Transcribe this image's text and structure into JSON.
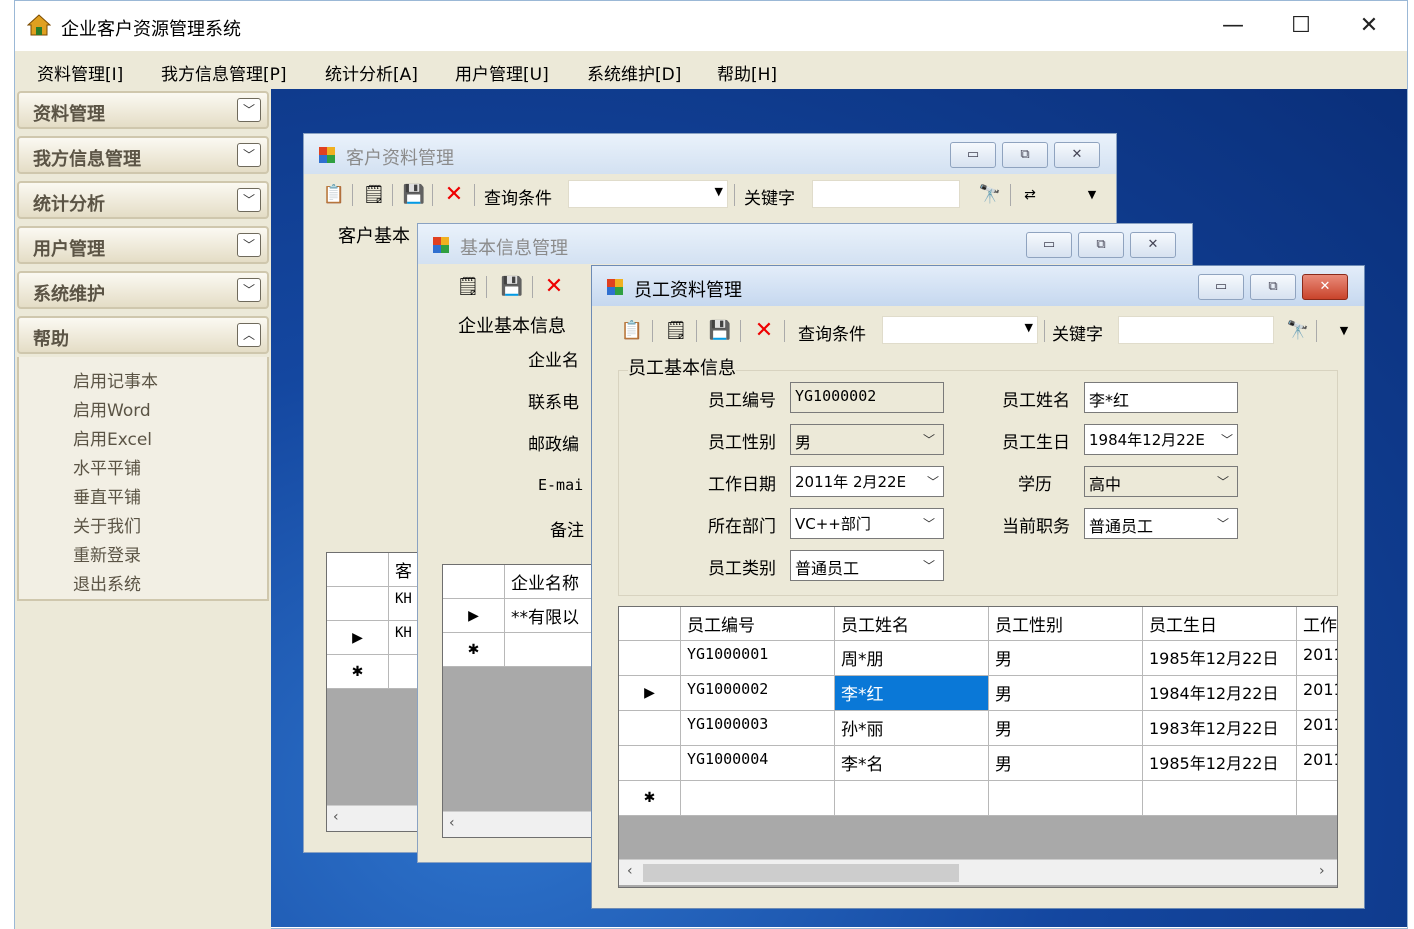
{
  "app": {
    "title": "企业客户资源管理系统"
  },
  "window_controls": {
    "minimize": "—",
    "maximize": "☐",
    "close": "✕"
  },
  "menu": [
    "资料管理[I]",
    "我方信息管理[P]",
    "统计分析[A]",
    "用户管理[U]",
    "系统维护[D]",
    "帮助[H]"
  ],
  "sidebar": {
    "groups": [
      "资料管理",
      "我方信息管理",
      "统计分析",
      "用户管理",
      "系统维护",
      "帮助"
    ],
    "help_items": [
      "启用记事本",
      "启用Word",
      "启用Excel",
      "水平平铺",
      "垂直平铺",
      "关于我们",
      "重新登录",
      "退出系统"
    ]
  },
  "win_customer": {
    "title": "客户资料管理",
    "query_label": "查询条件",
    "keyword_label": "关键字",
    "group_label": "客户基本",
    "grid_header": "客",
    "rows": [
      "KH",
      "KH"
    ]
  },
  "win_basic": {
    "title": "基本信息管理",
    "group_label": "企业基本信息",
    "labels": [
      "企业名",
      "联系电",
      "邮政编",
      "E-mai",
      "备注"
    ],
    "grid_header": "企业名称",
    "rows": [
      "**有限以"
    ]
  },
  "win_employee": {
    "title": "员工资料管理",
    "query_label": "查询条件",
    "keyword_label": "关键字",
    "group_label": "员工基本信息",
    "form": {
      "id_label": "员工编号",
      "id_value": "YG1000002",
      "name_label": "员工姓名",
      "name_value": "李*红",
      "gender_label": "员工性别",
      "gender_value": "男",
      "birth_label": "员工生日",
      "birth_value": "1984年12月22E",
      "work_label": "工作日期",
      "work_value": "2011年 2月22E",
      "edu_label": "学历",
      "edu_value": "高中",
      "dept_label": "所在部门",
      "dept_value": "VC++部门",
      "post_label": "当前职务",
      "post_value": "普通员工",
      "type_label": "员工类别",
      "type_value": "普通员工"
    },
    "grid": {
      "columns": [
        "员工编号",
        "员工姓名",
        "员工性别",
        "员工生日",
        "工作"
      ],
      "rows": [
        [
          "YG1000001",
          "周*朋",
          "男",
          "1985年12月22日",
          "2011"
        ],
        [
          "YG1000002",
          "李*红",
          "男",
          "1984年12月22日",
          "2011"
        ],
        [
          "YG1000003",
          "孙*丽",
          "男",
          "1983年12月22日",
          "2011"
        ],
        [
          "YG1000004",
          "李*名",
          "男",
          "1985年12月22日",
          "2011"
        ]
      ],
      "current_row_marker": "▶",
      "new_row_marker": "✱"
    }
  },
  "colors": {
    "mdi_background": "#1447a0",
    "selection": "#0a78d7",
    "delete_icon": "#e00000"
  }
}
